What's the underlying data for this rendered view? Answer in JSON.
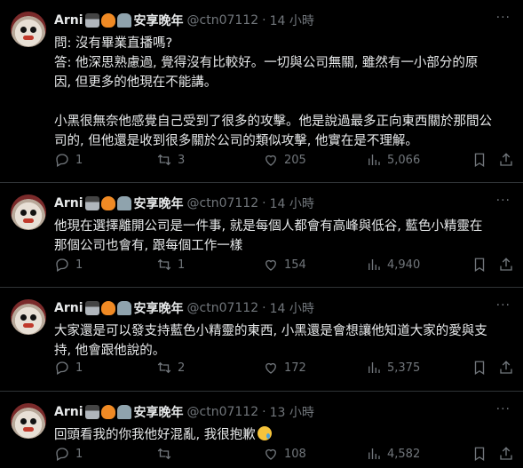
{
  "tweets": [
    {
      "name": "Arni",
      "display_suffix": "安享晚年",
      "handle": "@ctn07112",
      "time": "14 小時",
      "lines": [
        "問: 沒有畢業直播嗎?",
        "答: 他深思熟慮過, 覺得沒有比較好。一切與公司無關, 雖然有一小部分的原",
        "因, 但更多的他現在不能講。",
        "",
        "小黑很無奈他感覺自己受到了很多的攻擊。他是說過最多正向東西關於那間公",
        "司的, 但他還是收到很多關於公司的類似攻擊, 他實在是不理解。"
      ],
      "replies": "1",
      "retweets": "3",
      "likes": "205",
      "views": "5,066"
    },
    {
      "name": "Arni",
      "display_suffix": "安享晚年",
      "handle": "@ctn07112",
      "time": "14 小時",
      "lines": [
        "他現在選擇離開公司是一件事, 就是每個人都會有高峰與低谷, 藍色小精靈在",
        "那個公司也會有, 跟每個工作一樣"
      ],
      "replies": "1",
      "retweets": "1",
      "likes": "154",
      "views": "4,940"
    },
    {
      "name": "Arni",
      "display_suffix": "安享晚年",
      "handle": "@ctn07112",
      "time": "14 小時",
      "lines": [
        "大家還是可以發支持藍色小精靈的東西, 小黑還是會想讓他知道大家的愛與支",
        "持, 他會跟他說的。"
      ],
      "replies": "1",
      "retweets": "2",
      "likes": "172",
      "views": "5,375"
    },
    {
      "name": "Arni",
      "display_suffix": "安享晚年",
      "handle": "@ctn07112",
      "time": "13 小時",
      "lines": [
        "回頭看我的你我他好混亂, 我很抱歉"
      ],
      "replies": "1",
      "retweets": "",
      "likes": "108",
      "views": "4,582"
    }
  ],
  "icons": {
    "reply": "reply-icon",
    "retweet": "retweet-icon",
    "like": "heart-icon",
    "views": "views-icon",
    "bookmark": "bookmark-icon",
    "share": "share-icon",
    "more": "more-icon"
  },
  "more_glyph": "···",
  "colors": {
    "background": "#000000",
    "text": "#e7e9ea",
    "muted": "#71767b",
    "divider": "#2f3336"
  }
}
